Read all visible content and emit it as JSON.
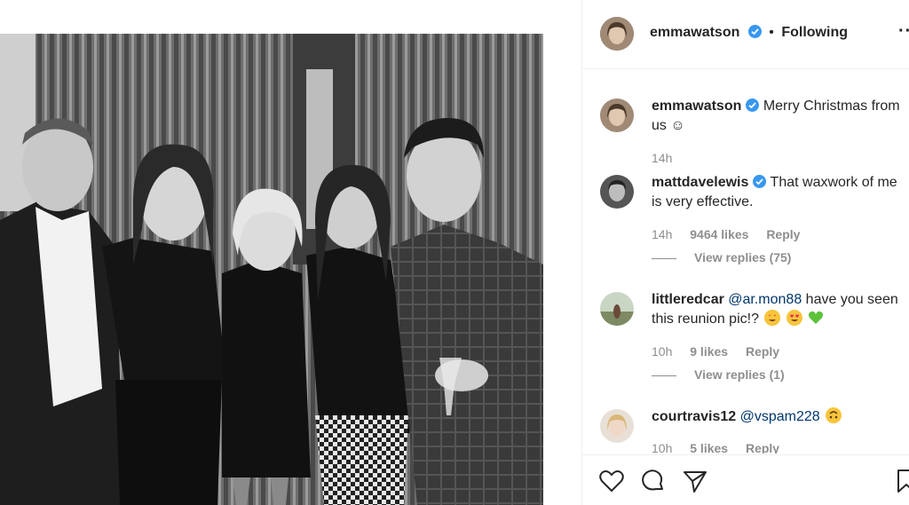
{
  "header": {
    "username": "emmawatson",
    "separator": "•",
    "follow_status": "Following",
    "more": "··"
  },
  "caption": {
    "username": "emmawatson",
    "text": "Merry Christmas from us ☺",
    "time": "14h"
  },
  "comments": [
    {
      "username": "mattdavelewis",
      "verified": true,
      "mention": "",
      "text": "That waxwork of me is very effective.",
      "time": "14h",
      "likes": "9464 likes",
      "reply": "Reply",
      "view_replies": "View replies (75)"
    },
    {
      "username": "littleredcar",
      "verified": false,
      "mention": "@ar.mon88",
      "text": "have you seen this reunion pic!?",
      "time": "10h",
      "likes": "9 likes",
      "reply": "Reply",
      "view_replies": "View replies (1)"
    },
    {
      "username": "courtravis12",
      "verified": false,
      "mention": "@vspam228",
      "text": "",
      "time": "10h",
      "likes": "5 likes",
      "reply": "Reply"
    }
  ],
  "actions": {
    "like": "heart-icon",
    "comment": "comment-icon",
    "share": "share-icon",
    "save": "bookmark-icon"
  },
  "colors": {
    "verified": "#3897f0",
    "mention": "#00376b",
    "meta": "#8e8e8e"
  }
}
